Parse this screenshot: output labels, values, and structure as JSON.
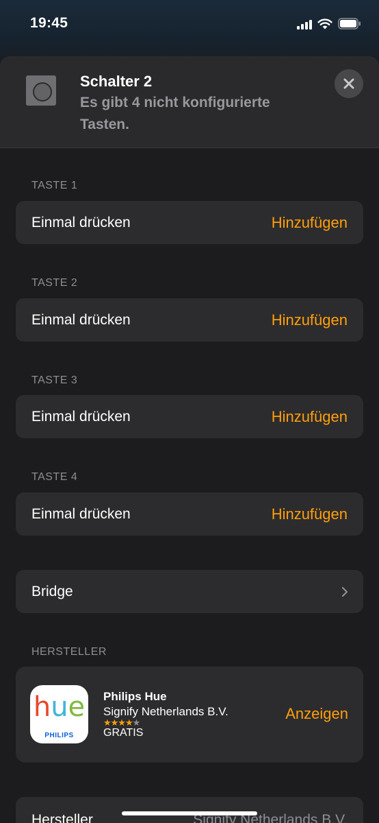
{
  "status_bar": {
    "time": "19:45"
  },
  "header": {
    "title": "Schalter 2",
    "subtitle": "Es gibt 4 nicht konfigurierte Tasten.",
    "close_icon": "close-icon"
  },
  "buttons": [
    {
      "section": "TASTE 1",
      "label": "Einmal drücken",
      "action": "Hinzufügen"
    },
    {
      "section": "TASTE 2",
      "label": "Einmal drücken",
      "action": "Hinzufügen"
    },
    {
      "section": "TASTE 3",
      "label": "Einmal drücken",
      "action": "Hinzufügen"
    },
    {
      "section": "TASTE 4",
      "label": "Einmal drücken",
      "action": "Hinzufügen"
    }
  ],
  "bridge": {
    "label": "Bridge"
  },
  "manufacturer_section": {
    "label": "HERSTELLER",
    "app": {
      "name": "Philips Hue",
      "developer": "Signify Netherlands B.V.",
      "rating_stars": 4.5,
      "price": "GRATIS",
      "action": "Anzeigen",
      "icon_wordmark": "hue",
      "icon_brand": "PHILIPS"
    }
  },
  "details": {
    "label": "Hersteller",
    "value": "Signify Netherlands B.V."
  },
  "colors": {
    "accent": "#ff9f0a",
    "background": "#1c1c1e",
    "row": "#2c2c2e",
    "secondary_text": "#8e8e93"
  }
}
